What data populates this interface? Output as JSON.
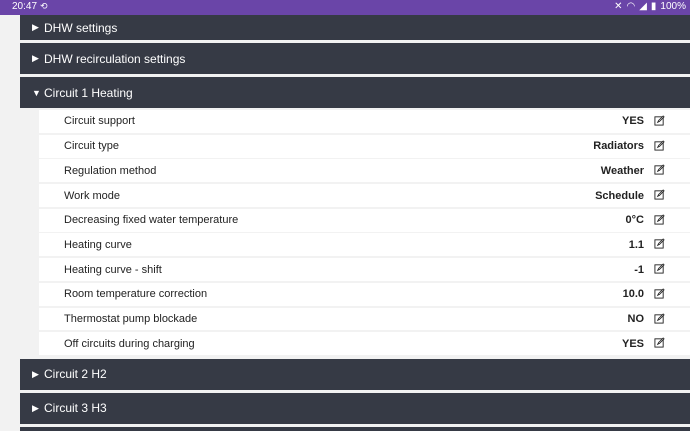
{
  "status_bar": {
    "time": "20:47",
    "time_icon": "sync-icon",
    "battery": "100%",
    "icons": [
      "mute-icon",
      "wifi-icon",
      "signal-icon",
      "battery-icon"
    ]
  },
  "sections": {
    "dhw_settings": "DHW settings",
    "dhw_recirculation": "DHW recirculation settings",
    "circuit1": "Circuit 1 Heating",
    "circuit2": "Circuit 2 H2",
    "circuit3": "Circuit 3 H3"
  },
  "circuit1_rows": [
    {
      "label": "Circuit support",
      "value": "YES"
    },
    {
      "label": "Circuit type",
      "value": "Radiators"
    },
    {
      "label": "Regulation method",
      "value": "Weather"
    },
    {
      "label": "Work mode",
      "value": "Schedule"
    },
    {
      "label": "Decreasing fixed water temperature",
      "value": "0°C"
    },
    {
      "label": "Heating curve",
      "value": "1.1"
    },
    {
      "label": "Heating curve - shift",
      "value": "-1"
    },
    {
      "label": "Room temperature correction",
      "value": "10.0"
    },
    {
      "label": "Thermostat pump blockade",
      "value": "NO"
    },
    {
      "label": "Off circuits during charging",
      "value": "YES"
    }
  ],
  "colors": {
    "status_bar": "#6a45a8",
    "section_header": "#363a45",
    "background": "#f2f2f2"
  }
}
